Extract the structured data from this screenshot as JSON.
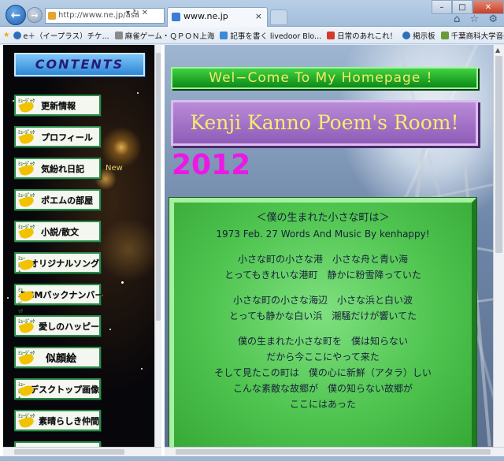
{
  "browser": {
    "address_text": "http://www.ne.jp/asa",
    "address_tools": "▾ ↻ ✕",
    "tab_title": "www.ne.jp",
    "tab_close": "×",
    "window_controls": [
      "–",
      "□",
      "✕"
    ],
    "right_icons": "⌂ ☆ ⚙"
  },
  "favorites": [
    {
      "label": "e＋（イープラス）チケ...",
      "icon": "globe-icon",
      "color": "#2d6fb8"
    },
    {
      "label": "麻雀ゲーム・ＱＰＯＮ上海",
      "icon": "page-icon",
      "color": "#8a8a8a"
    },
    {
      "label": "記事を書く livedoor Blo...",
      "icon": "blog-icon",
      "color": "#3a8ad6"
    },
    {
      "label": "日常のあれこれ！",
      "icon": "g-icon",
      "color": "#d43b2a"
    },
    {
      "label": "掲示板",
      "icon": "globe-icon",
      "color": "#2d6fb8"
    },
    {
      "label": "千葉商科大学音楽部OB...",
      "icon": "page-icon",
      "color": "#6a9a3a"
    }
  ],
  "sidebar": {
    "contents_label": "CONTENTS",
    "new_badge": "New",
    "items": [
      {
        "label": "更新情報",
        "tag": "music"
      },
      {
        "label": "プロフィール",
        "tag": "music"
      },
      {
        "label": "気紛れ日記",
        "tag": "music"
      },
      {
        "label": "ポエムの部屋",
        "tag": "music"
      },
      {
        "label": "小説/散文",
        "tag": "music"
      },
      {
        "label": "オリジナルソング",
        "tag": "music"
      },
      {
        "label": "BGMバックナンバー",
        "tag": "music"
      },
      {
        "label": "愛しのハッピー",
        "tag": "music"
      },
      {
        "label": "似顔絵",
        "tag": "music"
      },
      {
        "label": "デスクトップ画像",
        "tag": "music"
      },
      {
        "label": "素晴らしき仲間",
        "tag": "music"
      }
    ]
  },
  "main": {
    "welcome": "Wel−Come  To  My  Homepage  ！",
    "title": "Kenji Kanno Poem's Room!",
    "year": "2012",
    "poem": {
      "title": "＜僕の生まれた小さな町は＞",
      "credit": "1973  Feb. 27  Words And Music By kenhappy!",
      "stanza1": [
        "小さな町の小さな港　小さな舟と青い海",
        "とってもきれいな港町　静かに粉雪降っていた"
      ],
      "stanza2": [
        "小さな町の小さな海辺　小さな浜と白い波",
        "とっても静かな白い浜　潮騒だけが響いてた"
      ],
      "stanza3": [
        "僕の生まれた小さな町を　僕は知らない",
        "だから今ここにやって来た",
        "そして見たこの町は　僕の心に新鮮（アタラ）しい",
        "こんな素敵な故郷が　僕の知らない故郷が",
        "ここにはあった"
      ]
    }
  }
}
